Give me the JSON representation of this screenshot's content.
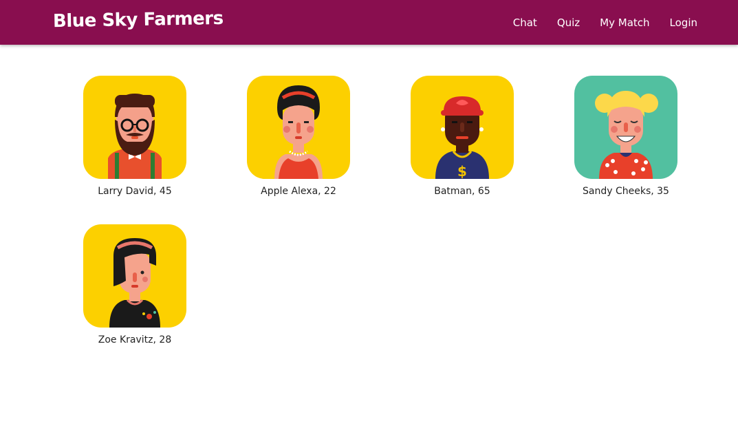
{
  "brand": {
    "title": "Blue Sky Farmers"
  },
  "nav": {
    "items": [
      {
        "label": "Chat"
      },
      {
        "label": "Quiz"
      },
      {
        "label": "My Match"
      },
      {
        "label": "Login"
      }
    ]
  },
  "colors": {
    "navbar": "#890e4f",
    "avatar_yellow": "#fcd000",
    "avatar_teal": "#52c0a0"
  },
  "profiles": [
    {
      "name": "Larry David, 45",
      "avatar_icon": "bearded-man-avatar-icon"
    },
    {
      "name": "Apple Alexa, 22",
      "avatar_icon": "woman-red-dress-avatar-icon"
    },
    {
      "name": "Batman, 65",
      "avatar_icon": "man-bandana-avatar-icon"
    },
    {
      "name": "Sandy Cheeks, 35",
      "avatar_icon": "blonde-woman-avatar-icon"
    },
    {
      "name": "Zoe Kravitz, 28",
      "avatar_icon": "woman-bangs-avatar-icon"
    }
  ]
}
